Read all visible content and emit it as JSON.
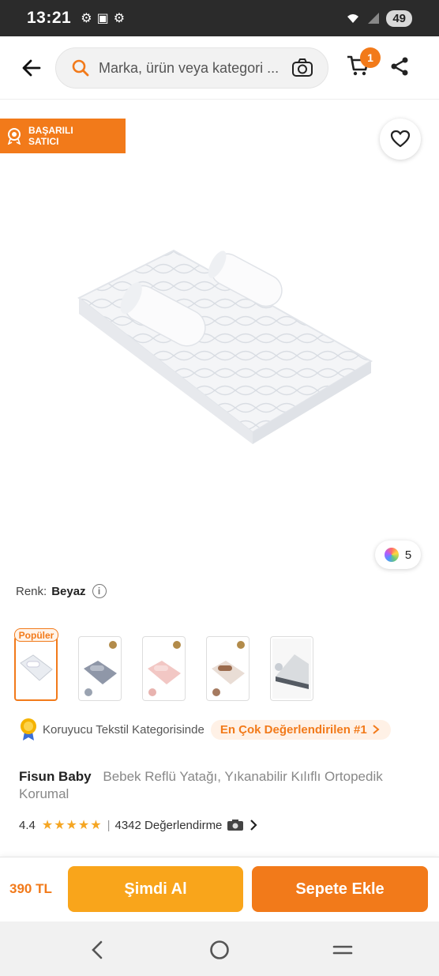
{
  "status_bar": {
    "time": "13:21",
    "battery": "49"
  },
  "search": {
    "placeholder": "Marka, ürün veya kategori ..."
  },
  "cart": {
    "count": "1"
  },
  "seller_badge": {
    "label": "BAŞARILI SATICI"
  },
  "color_count": "5",
  "variant": {
    "label": "Renk:",
    "value": "Beyaz",
    "popular_tag": "Popüler"
  },
  "thumbnails": [
    "Beyaz",
    "Gri",
    "Pembe",
    "Kahverengi",
    "Reflü"
  ],
  "category": {
    "text": "Koruyucu Tekstil Kategorisinde",
    "link": "En Çok Değerlendirilen #1"
  },
  "product": {
    "brand": "Fisun Baby",
    "title": "Bebek Reflü Yatağı, Yıkanabilir Kılıflı Ortopedik Korumal"
  },
  "rating": {
    "score": "4.4",
    "stars": "★★★★★",
    "reviews": "4342 Değerlendirme"
  },
  "bottom": {
    "price": "390 TL",
    "buy_now": "Şimdi Al",
    "add_to_cart": "Sepete Ekle"
  },
  "colors": {
    "accent": "#f27a1a",
    "buy_now": "#f9a51b"
  }
}
